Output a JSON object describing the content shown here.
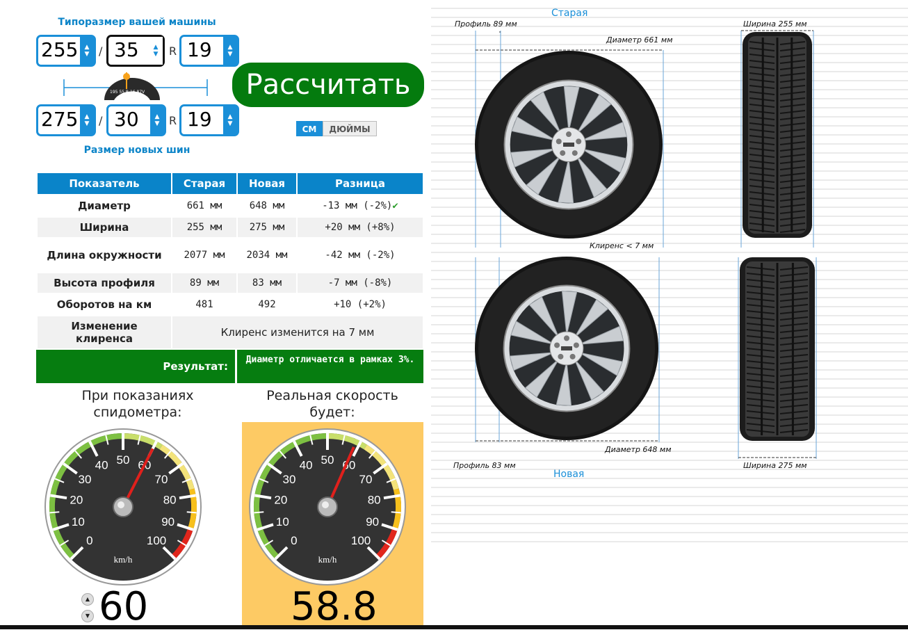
{
  "form": {
    "old_title": "Типоразмер вашей машины",
    "new_title": "Размер новых шин",
    "old": {
      "width": "255",
      "profile": "35",
      "radius": "19"
    },
    "new": {
      "width": "275",
      "profile": "30",
      "radius": "19"
    },
    "slash": "/",
    "r_letter": "R",
    "calc_button": "Рассчитать",
    "units": {
      "cm": "СМ",
      "inch": "ДЮЙМЫ"
    }
  },
  "table": {
    "headers": [
      "Показатель",
      "Старая",
      "Новая",
      "Разница"
    ],
    "rows": [
      {
        "label": "Диаметр",
        "old": "661 мм",
        "new": "648 мм",
        "diff": "-13 мм (-2%)"
      },
      {
        "label": "Ширина",
        "old": "255 мм",
        "new": "275 мм",
        "diff": "+20 мм (+8%)"
      },
      {
        "label": "Длина окружности",
        "old": "2077 мм",
        "new": "2034 мм",
        "diff": "-42 мм (-2%)"
      },
      {
        "label": "Высота профиля",
        "old": "89 мм",
        "new": "83 мм",
        "diff": "-7 мм (-8%)"
      },
      {
        "label": "Оборотов на км",
        "old": "481",
        "new": "492",
        "diff": "+10 (+2%)"
      }
    ],
    "clearance_label": "Изменение клиренса",
    "clearance_value": "Клиренс изменится на 7 мм",
    "result_label": "Результат:",
    "result_value": "Диаметр отличается в рамках 3%."
  },
  "speed": {
    "left_title": "При показаниях спидометра:",
    "right_title": "Реальная скорость будет:",
    "speedometer_value": "60",
    "real_value": "58.8",
    "unit": "km/h",
    "ticks": [
      "0",
      "10",
      "20",
      "30",
      "40",
      "50",
      "60",
      "70",
      "80",
      "90",
      "100"
    ]
  },
  "diagram": {
    "old_caption": "Старая",
    "new_caption": "Новая",
    "old_profile": "Профиль 89 мм",
    "old_diameter": "Диаметр 661 мм",
    "old_width": "Ширина 255 мм",
    "clearance": "Клиренс < 7 мм",
    "new_diameter": "Диаметр 648 мм",
    "new_profile": "Профиль 83 мм",
    "new_width": "Ширина 275 мм"
  },
  "colors": {
    "accent": "#1a8fd8",
    "header": "#0a84c9",
    "result": "#067d10",
    "highlight": "#fdca64"
  }
}
